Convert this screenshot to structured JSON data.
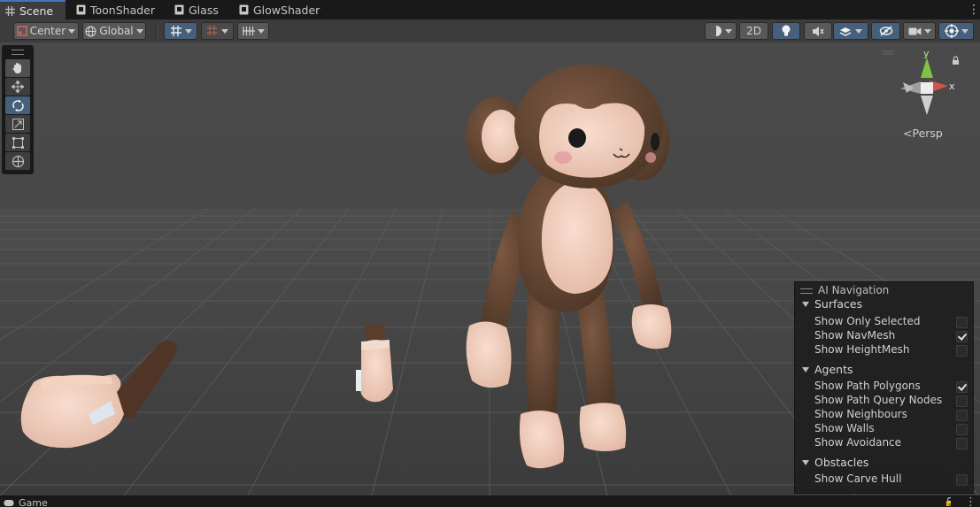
{
  "tabs": [
    {
      "label": "Scene",
      "icon": "grid-icon"
    },
    {
      "label": "ToonShader",
      "icon": "shader-icon"
    },
    {
      "label": "Glass",
      "icon": "shader-icon"
    },
    {
      "label": "GlowShader",
      "icon": "shader-icon"
    }
  ],
  "active_tab": "Scene",
  "toolbar": {
    "pivot_mode": "Center",
    "pivot_rotation": "Global",
    "view_2d_label": "2D"
  },
  "tools": [
    "hand-tool",
    "move-tool",
    "rotate-tool",
    "scale-tool",
    "rect-tool",
    "transform-tool"
  ],
  "active_tool": "rotate-tool",
  "gizmo": {
    "y_label": "y",
    "x_label": "x",
    "projection": "Persp"
  },
  "ai_navigation": {
    "title": "AI Navigation",
    "sections": [
      {
        "title": "Surfaces",
        "options": [
          {
            "label": "Show Only Selected",
            "checked": false
          },
          {
            "label": "Show NavMesh",
            "checked": true
          },
          {
            "label": "Show HeightMesh",
            "checked": false
          }
        ]
      },
      {
        "title": "Agents",
        "options": [
          {
            "label": "Show Path Polygons",
            "checked": true
          },
          {
            "label": "Show Path Query Nodes",
            "checked": false
          },
          {
            "label": "Show Neighbours",
            "checked": false
          },
          {
            "label": "Show Walls",
            "checked": false
          },
          {
            "label": "Show Avoidance",
            "checked": false
          }
        ]
      },
      {
        "title": "Obstacles",
        "options": [
          {
            "label": "Show Carve Hull",
            "checked": false
          }
        ]
      }
    ]
  },
  "bottom_tab": {
    "label": "Game"
  },
  "colors": {
    "accent": "#3a79bb",
    "active_button": "#46607c",
    "monkey_fur": "#5b4030",
    "monkey_skin": "#efcfbd"
  }
}
